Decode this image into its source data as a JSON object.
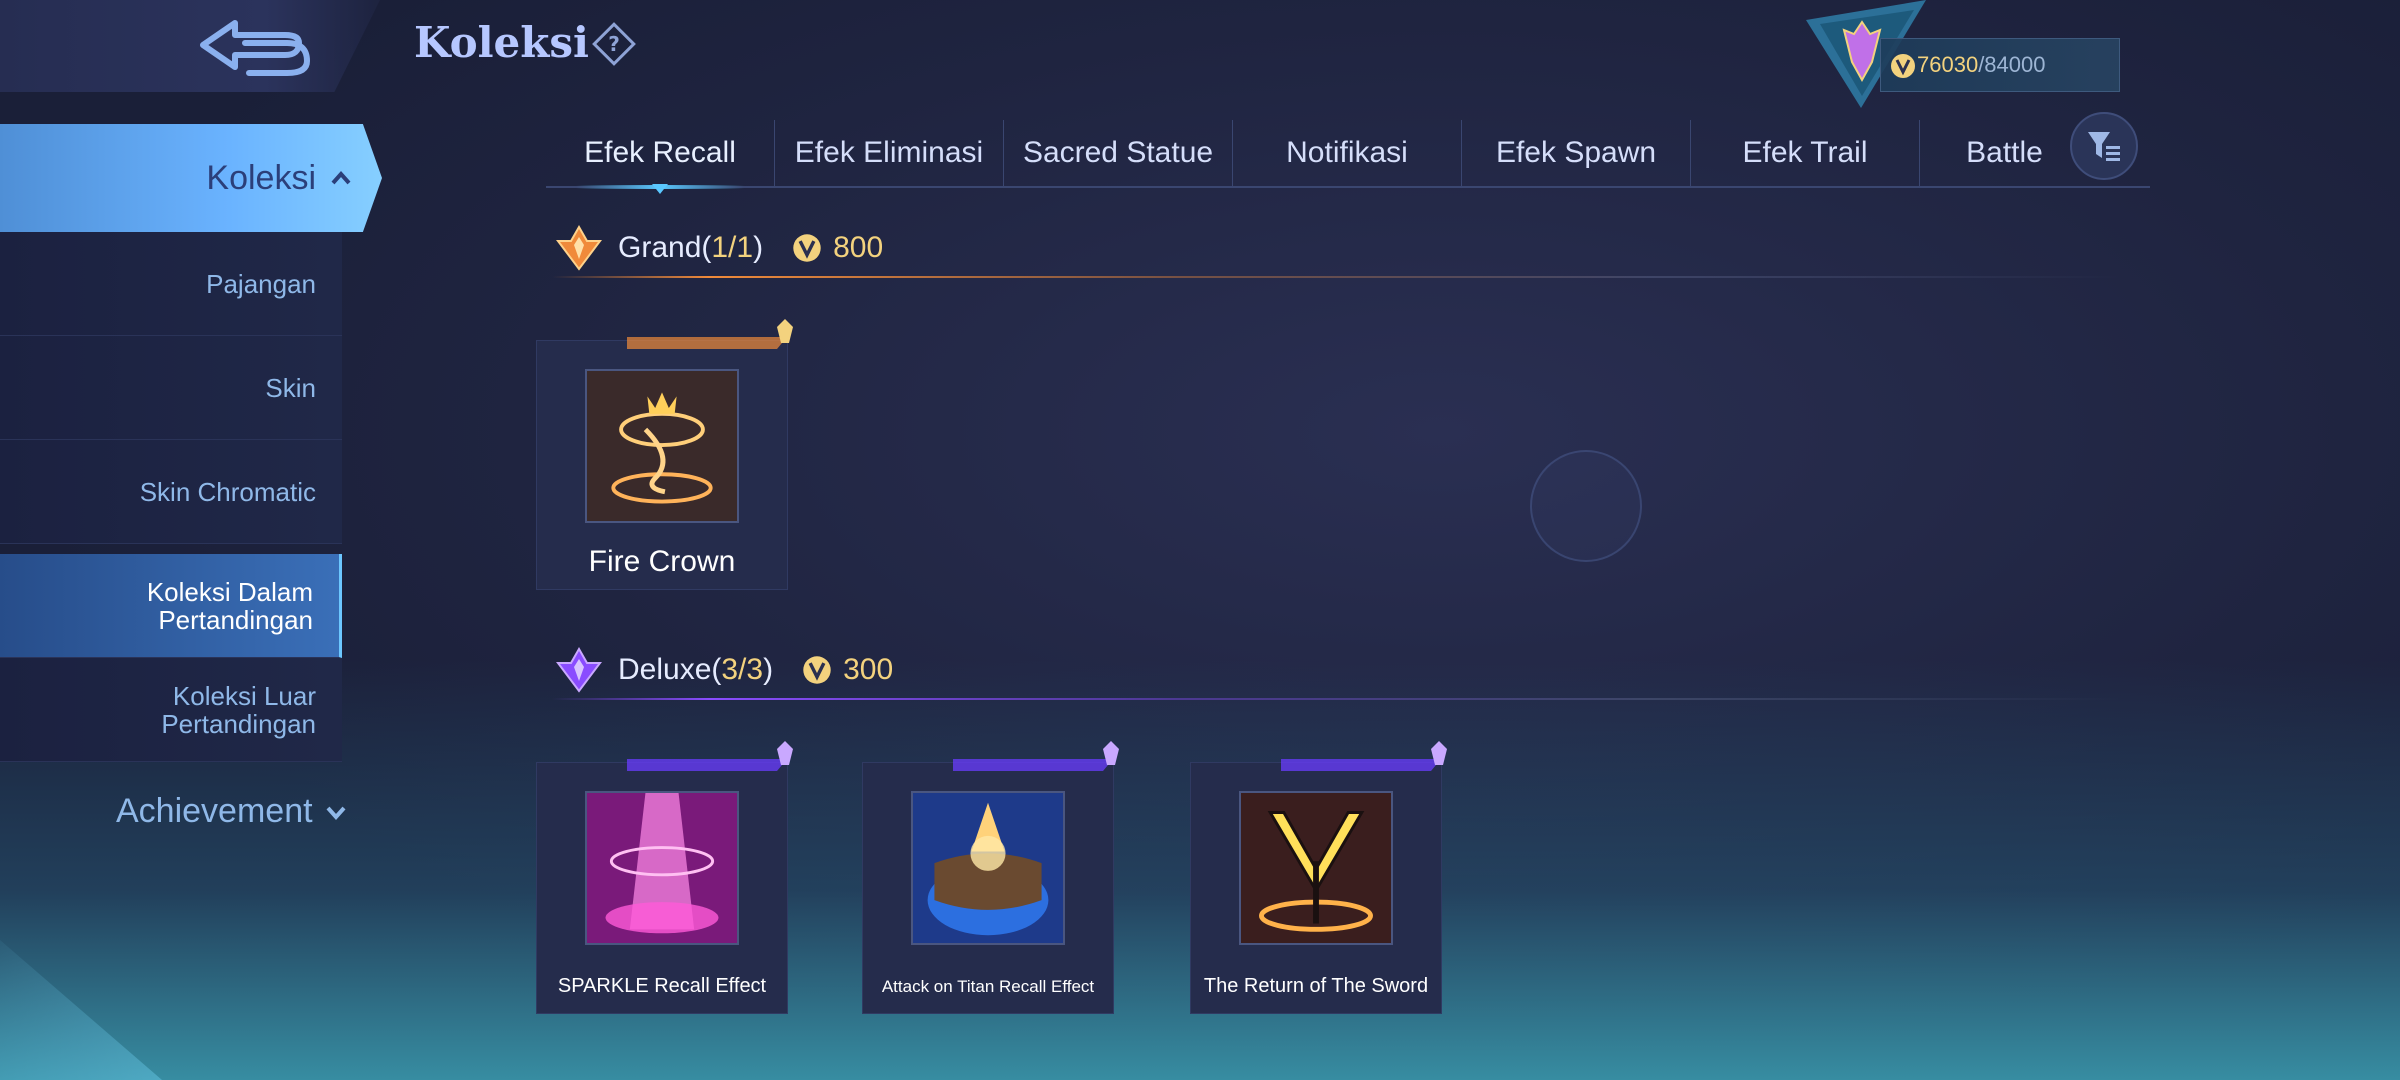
{
  "header": {
    "title": "Koleksi",
    "currency_value": "76030",
    "currency_max": "/84000"
  },
  "sidebar": {
    "main": {
      "label": "Koleksi"
    },
    "items": [
      {
        "label": "Pajangan"
      },
      {
        "label": "Skin"
      },
      {
        "label": "Skin Chromatic"
      },
      {
        "label": "Koleksi Dalam Pertandingan"
      },
      {
        "label": "Koleksi Luar Pertandingan"
      }
    ],
    "achievement": "Achievement"
  },
  "tabs": [
    {
      "label": "Efek Recall"
    },
    {
      "label": "Efek Eliminasi"
    },
    {
      "label": "Sacred Statue"
    },
    {
      "label": "Notifikasi"
    },
    {
      "label": "Efek Spawn"
    },
    {
      "label": "Efek Trail"
    },
    {
      "label": "Battle"
    }
  ],
  "sections": {
    "grand": {
      "name": "Grand(",
      "count": "1/1",
      "close": ")",
      "price": "800"
    },
    "deluxe": {
      "name": "Deluxe(",
      "count": "3/3",
      "close": ")",
      "price": "300"
    }
  },
  "cards": {
    "fire_crown": {
      "name": "Fire Crown"
    },
    "sparkle": {
      "name": "SPARKLE Recall Effect"
    },
    "aot": {
      "name": "Attack on Titan Recall Effect"
    },
    "sword": {
      "name": "The Return of The Sword"
    }
  },
  "colors": {
    "accent": "#5ac8ff",
    "gold": "#f3d27e",
    "grand": "#f08a3a",
    "deluxe": "#8a4cff"
  }
}
